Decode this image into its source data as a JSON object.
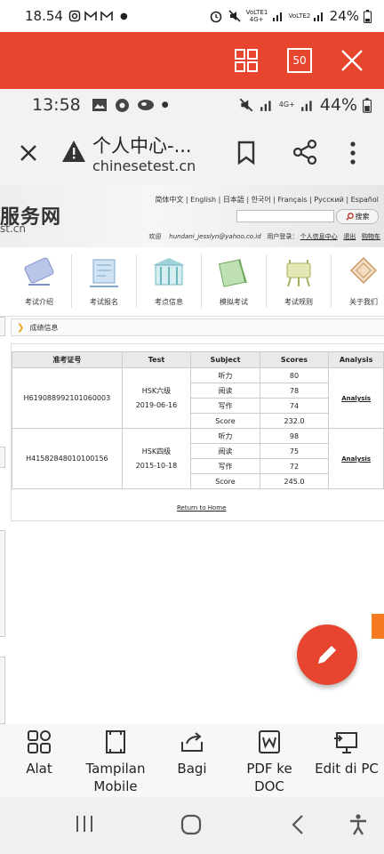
{
  "status_outer": {
    "time": "18.54",
    "network1": "VoLTE1 4G+",
    "network2": "VoLTE2",
    "battery": "24%"
  },
  "toolbar": {
    "tab_count": "50"
  },
  "status_inner": {
    "time": "13:58",
    "battery": "44%",
    "network": "4G+"
  },
  "browser": {
    "title": "个人中心-...",
    "url": "chinesetest.cn"
  },
  "site": {
    "logo": "服务网",
    "logo_sub": "st.cn",
    "languages": "简体中文 | English | 日本語 | 한국어 | Français | Русский | Español",
    "search_button": "搜索",
    "welcome": "欢迎",
    "email": "hundani_jesslyn@yahoo.co.id",
    "user_login": "用户登录：",
    "personal_center": "个人信息中心",
    "logout": "退出",
    "cart": "购物车"
  },
  "nav": {
    "items": [
      {
        "label": "考试介绍"
      },
      {
        "label": "考试报名"
      },
      {
        "label": "考点信息"
      },
      {
        "label": "模拟考试"
      },
      {
        "label": "考试规则"
      },
      {
        "label": "关于我们"
      }
    ]
  },
  "section": {
    "title": "成绩信息"
  },
  "table": {
    "headers": [
      "准考证号",
      "Test",
      "Subject",
      "Scores",
      "Analysis"
    ],
    "records": [
      {
        "id": "H619088992101060003",
        "test": "HSK六级",
        "date": "2019-06-16",
        "rows": [
          {
            "subject": "听力",
            "score": "80"
          },
          {
            "subject": "阅读",
            "score": "78"
          },
          {
            "subject": "写作",
            "score": "74"
          },
          {
            "subject": "Score",
            "score": "232.0"
          }
        ],
        "analysis": "Analysis"
      },
      {
        "id": "H41582848010100156",
        "test": "HSK四级",
        "date": "2015-10-18",
        "rows": [
          {
            "subject": "听力",
            "score": "98"
          },
          {
            "subject": "阅读",
            "score": "75"
          },
          {
            "subject": "写作",
            "score": "72"
          },
          {
            "subject": "Score",
            "score": "245.0"
          }
        ],
        "analysis": "Analysis"
      }
    ],
    "return_home": "Return to Home"
  },
  "bottom_tools": [
    {
      "label": "Alat",
      "icon": "grid-icon"
    },
    {
      "label": "Tampilan Mobile",
      "icon": "mobile-view-icon"
    },
    {
      "label": "Bagi",
      "icon": "share-icon"
    },
    {
      "label": "PDF ke DOC",
      "icon": "word-doc-icon"
    },
    {
      "label": "Edit di PC",
      "icon": "pc-icon"
    }
  ],
  "colors": {
    "accent": "#e8452f",
    "orange": "#f47b20"
  }
}
